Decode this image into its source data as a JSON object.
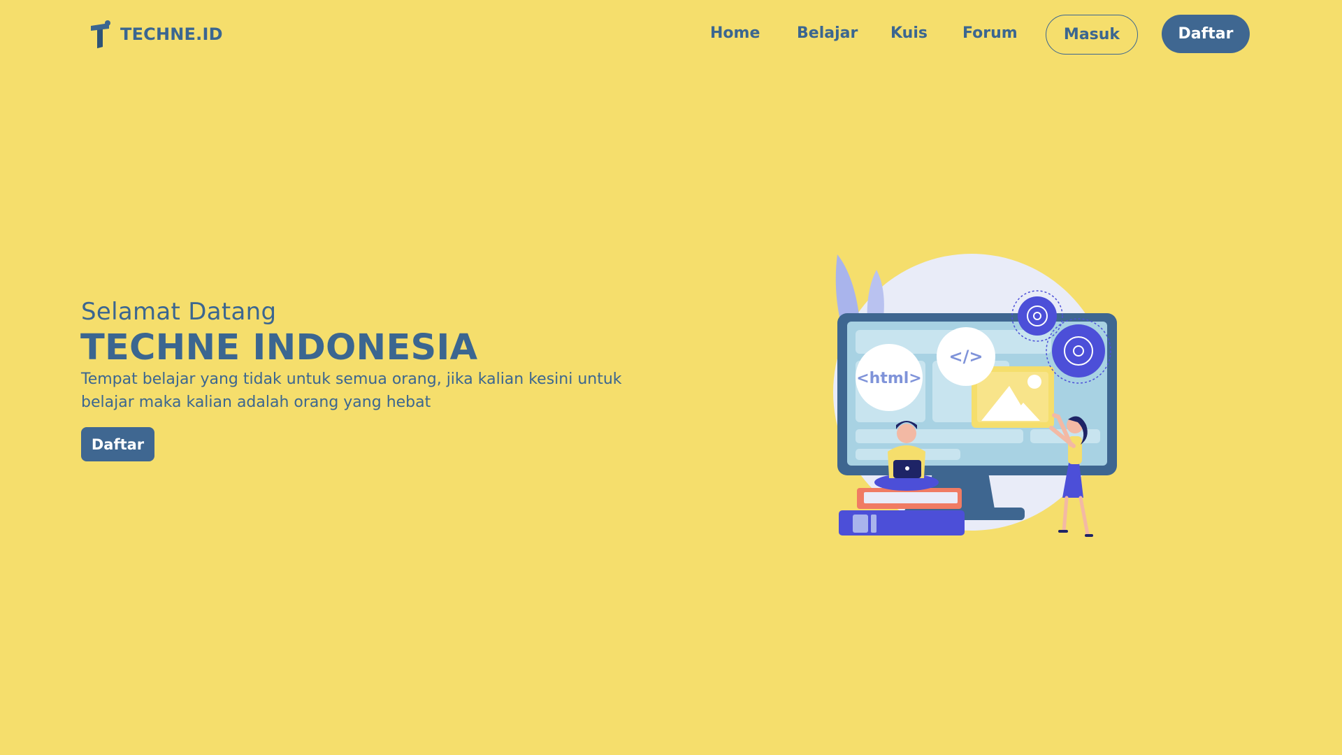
{
  "navbar": {
    "brand": "TECHNE.ID",
    "links": [
      {
        "label": "Home"
      },
      {
        "label": "Belajar"
      },
      {
        "label": "Kuis"
      },
      {
        "label": "Forum"
      }
    ],
    "login_label": "Masuk",
    "register_label": "Daftar"
  },
  "hero": {
    "subtitle": "Selamat Datang",
    "title": "TECHNE INDONESIA",
    "description": "Tempat belajar yang tidak untuk semua orang, jika kalian kesini untuk belajar maka kalian adalah orang yang hebat",
    "cta_label": "Daftar"
  },
  "illustration": {
    "html_tag": "<html>",
    "code_tag": "</>"
  },
  "colors": {
    "background": "#F5DE6C",
    "primary": "#3B6690",
    "button": "#3F6791",
    "button_text": "#FFFFFF",
    "accent_purple": "#4C4FD8",
    "accent_light": "#E9ECF8"
  }
}
